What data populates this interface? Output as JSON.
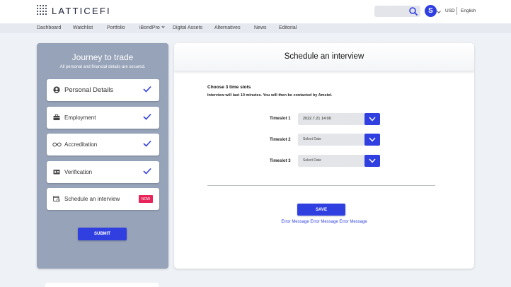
{
  "app": {
    "brand": "LATTICEFI",
    "avatar_letter": "S",
    "currency": "USD",
    "language": "English"
  },
  "nav": {
    "items": [
      "Dashboard",
      "Watchlist",
      "Portfolio",
      "iBondPro",
      "Digital Assets",
      "Alternatives",
      "News",
      "Editorial"
    ]
  },
  "journey": {
    "title": "Journey to trade",
    "subtitle": "All personal and financial details are secured.",
    "steps": [
      {
        "label": "Personal Details",
        "icon": "user-circle-icon",
        "status": "done"
      },
      {
        "label": "Employment",
        "icon": "briefcase-icon",
        "status": "done"
      },
      {
        "label": "Accreditation",
        "icon": "glasses-icon",
        "status": "done"
      },
      {
        "label": "Verification",
        "icon": "id-card-icon",
        "status": "done"
      },
      {
        "label": "Schedule an interview",
        "icon": "calendar-clock-icon",
        "status": "current",
        "badge": "NOW"
      }
    ],
    "submit_label": "SUBMIT"
  },
  "interview": {
    "title": "Schedule an interview",
    "choose_label": "Choose 3 time slots",
    "note": "Interview will last 10 minutes. You will then be contacted by Amstel.",
    "timeslots": [
      {
        "label": "Timeslot 1",
        "value": "2022.7.21   14:00"
      },
      {
        "label": "Timeslot 2",
        "value": "Select Date"
      },
      {
        "label": "Timeslot 3",
        "value": "Select Date"
      }
    ],
    "save_label": "SAVE",
    "error_message": "Error Message Error Message Error Message"
  },
  "colors": {
    "accent": "#2f3fe0",
    "panel": "#97a3b8",
    "badge": "#e8245a",
    "background": "#eef1f6"
  }
}
